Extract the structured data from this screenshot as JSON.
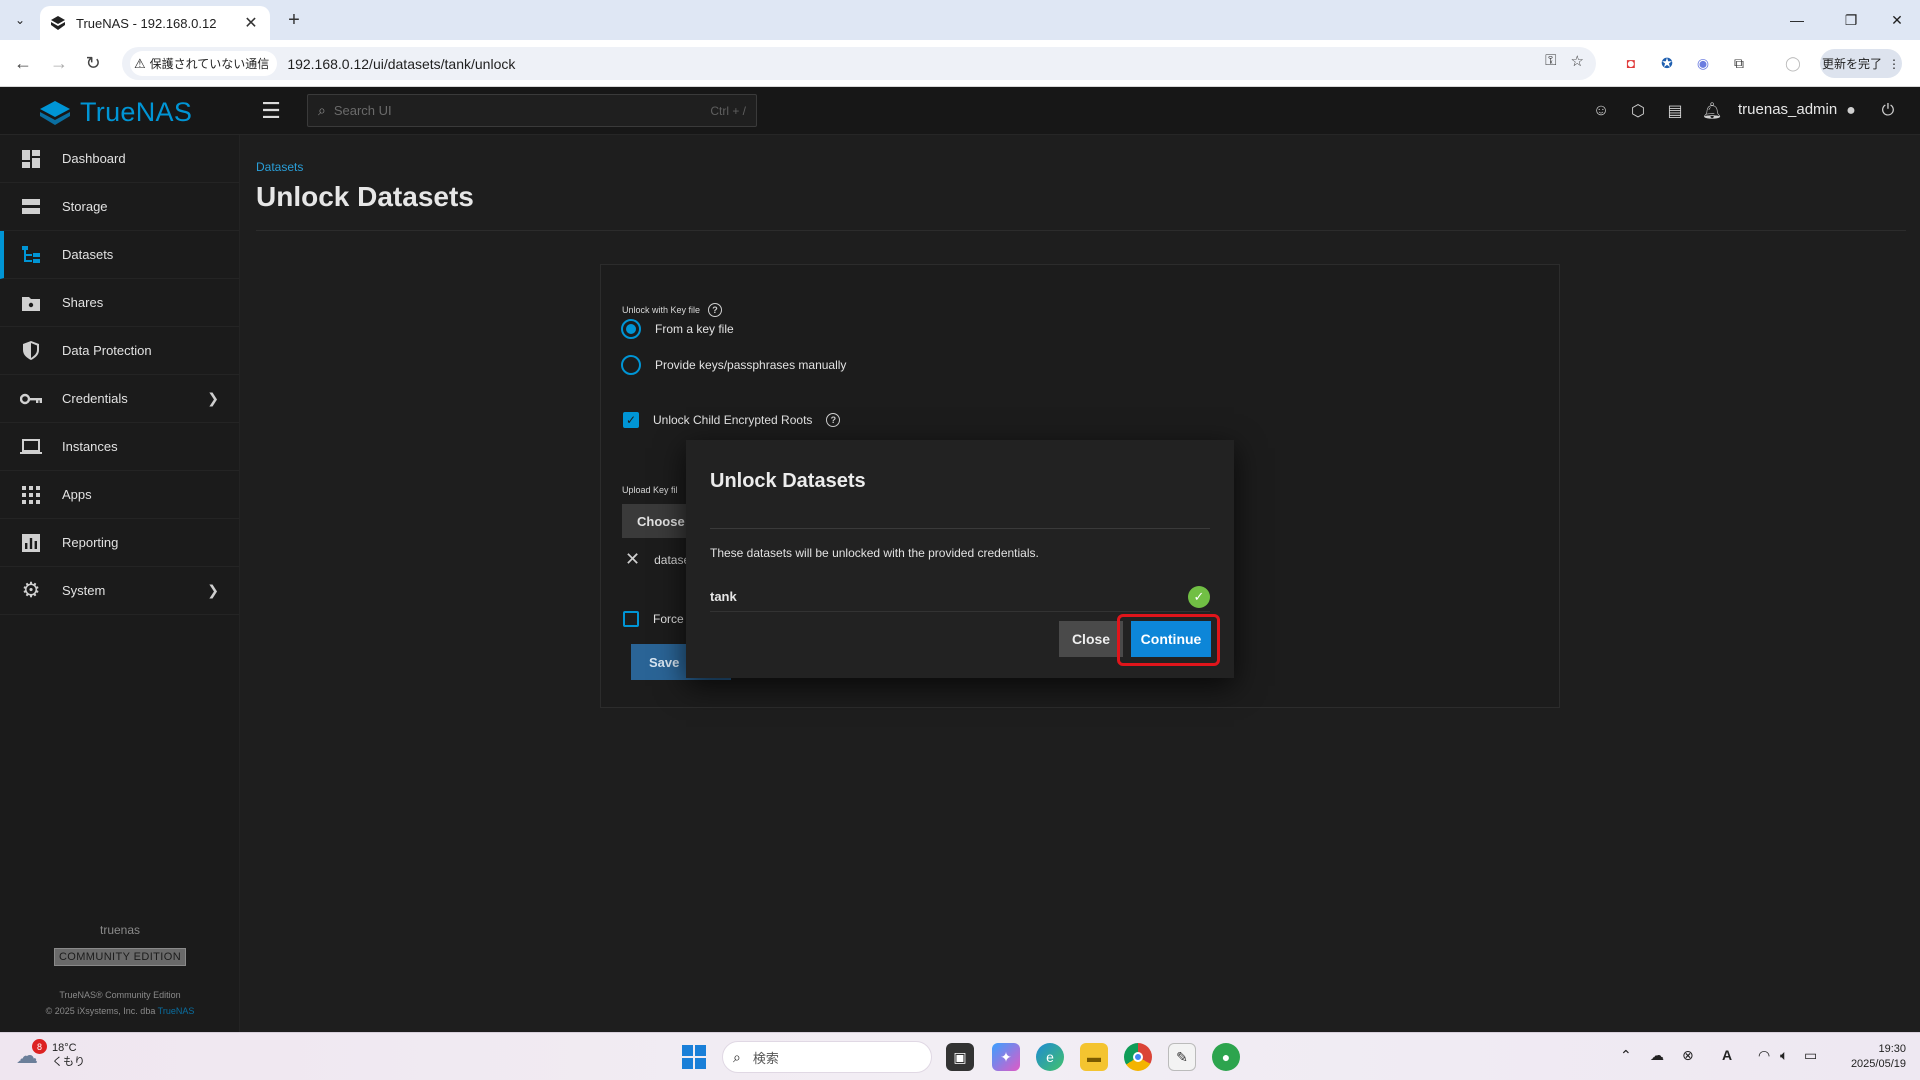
{
  "browser": {
    "tab_title": "TrueNAS - 192.168.0.12",
    "security_chip": "保護されていない通信",
    "url": "192.168.0.12/ui/datasets/tank/unlock",
    "update_button": "更新を完了"
  },
  "header": {
    "brand": "TrueNAS",
    "search_placeholder": "Search UI",
    "search_shortcut": "Ctrl + /",
    "username": "truenas_admin"
  },
  "sidebar": {
    "items": [
      {
        "label": "Dashboard",
        "icon": "dashboard-icon"
      },
      {
        "label": "Storage",
        "icon": "storage-icon"
      },
      {
        "label": "Datasets",
        "icon": "datasets-icon",
        "active": true
      },
      {
        "label": "Shares",
        "icon": "shares-icon"
      },
      {
        "label": "Data Protection",
        "icon": "shield-icon"
      },
      {
        "label": "Credentials",
        "icon": "key-icon",
        "expandable": true
      },
      {
        "label": "Instances",
        "icon": "laptop-icon"
      },
      {
        "label": "Apps",
        "icon": "apps-grid-icon"
      },
      {
        "label": "Reporting",
        "icon": "chart-icon"
      },
      {
        "label": "System",
        "icon": "gear-icon",
        "expandable": true
      }
    ],
    "hostname": "truenas",
    "edition_badge": "COMMUNITY EDITION",
    "copyright_line1": "TrueNAS® Community Edition",
    "copyright_line2_prefix": "© 2025 iXsystems, Inc. dba",
    "copyright_link": "TrueNAS"
  },
  "main": {
    "breadcrumb": "Datasets",
    "title": "Unlock Datasets",
    "form": {
      "key_group_label": "Unlock with Key file",
      "radio_from_file": "From a key file",
      "radio_manual": "Provide keys/passphrases manually",
      "selected_option": "From a key file",
      "unlock_child_label": "Unlock Child Encrypted Roots",
      "unlock_child_checked": true,
      "upload_label": "Upload Key fil",
      "choose_button": "Choose f",
      "file_name": "datase",
      "force_label": "Force",
      "force_checked": false,
      "save_button": "Save"
    }
  },
  "dialog": {
    "title": "Unlock Datasets",
    "message": "These datasets will be unlocked with the provided credentials.",
    "datasets": [
      {
        "name": "tank",
        "status": "success"
      }
    ],
    "close_button": "Close",
    "continue_button": "Continue"
  },
  "taskbar": {
    "weather_temp": "18°C",
    "weather_desc": "くもり",
    "weather_badge": "8",
    "search_placeholder": "検索",
    "time": "19:30",
    "date": "2025/05/19"
  },
  "colors": {
    "accent": "#0095d5",
    "continue_blue": "#0d86d8",
    "success_green": "#71bf44",
    "highlight_red": "#e0151b"
  }
}
